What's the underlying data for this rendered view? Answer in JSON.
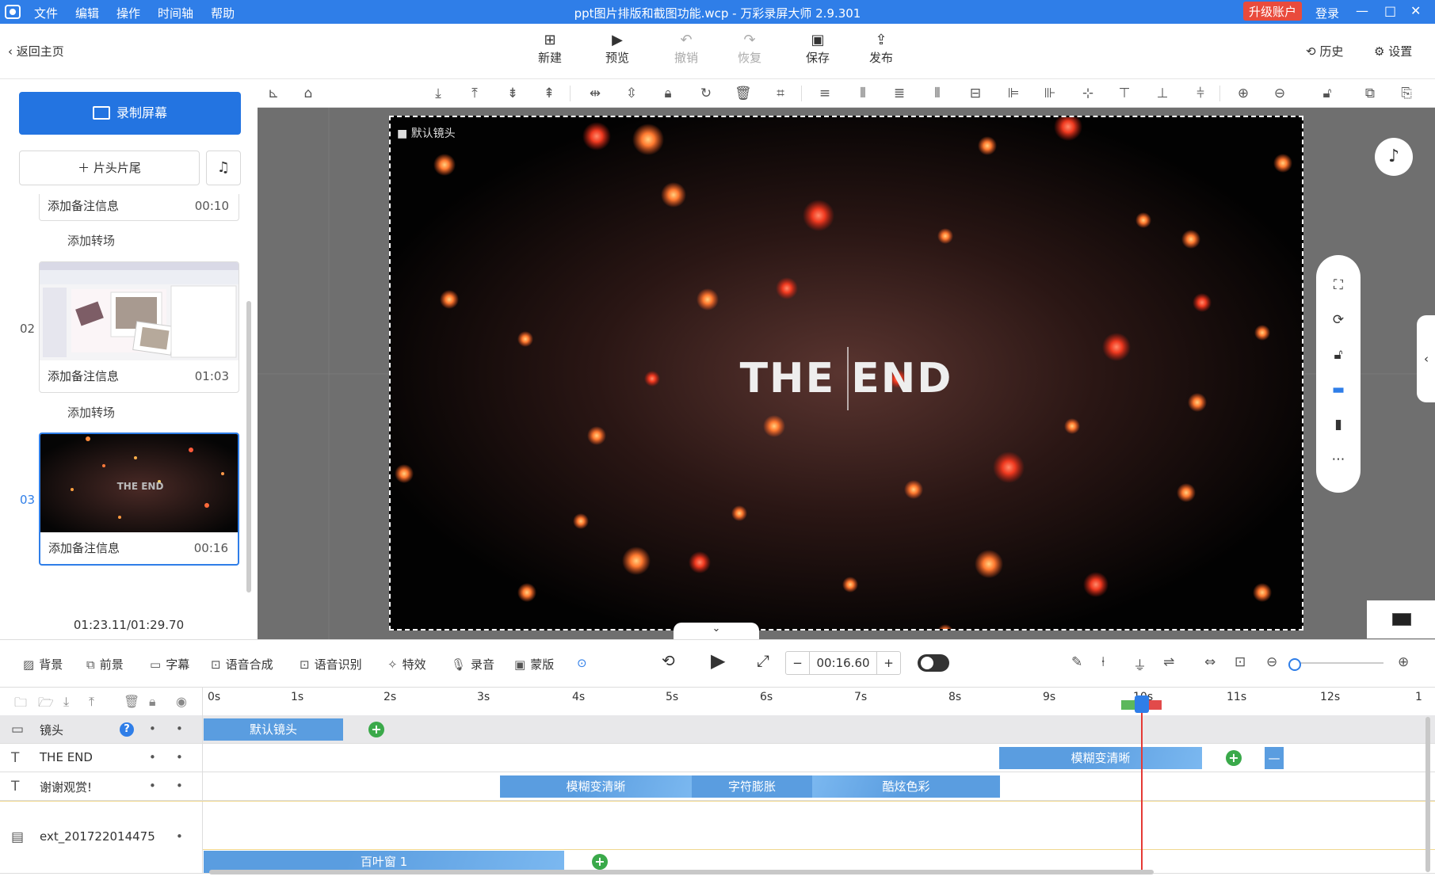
{
  "titlebar": {
    "menu": [
      "文件",
      "编辑",
      "操作",
      "时间轴",
      "帮助"
    ],
    "title": "ppt图片排版和截图功能.wcp - 万彩录屏大师 2.9.301",
    "upgrade": "升级账户",
    "login": "登录"
  },
  "toolbar": {
    "back": "返回主页",
    "new": "新建",
    "preview": "预览",
    "undo": "撤销",
    "redo": "恢复",
    "save": "保存",
    "publish": "发布",
    "history": "历史",
    "settings": "设置"
  },
  "left": {
    "record": "录制屏幕",
    "intro_outro": "片头片尾",
    "clips": [
      {
        "num": "",
        "caption": "添加备注信息",
        "time": "00:10"
      },
      {
        "num": "02",
        "caption": "添加备注信息",
        "time": "01:03"
      },
      {
        "num": "03",
        "caption": "添加备注信息",
        "time": "00:16"
      }
    ],
    "add_transition": "添加转场",
    "total_time": "01:23.11/01:29.70"
  },
  "canvas": {
    "camera_label": "默认镜头",
    "text": "THE END"
  },
  "controls": {
    "background": "背景",
    "foreground": "前景",
    "subtitle": "字幕",
    "tts": "语音合成",
    "asr": "语音识别",
    "effects": "特效",
    "record_audio": "录音",
    "mask": "蒙版",
    "time": "00:16.60"
  },
  "timeline": {
    "ticks": [
      "0s",
      "1s",
      "2s",
      "3s",
      "4s",
      "5s",
      "6s",
      "7s",
      "8s",
      "9s",
      "10s",
      "11s",
      "12s",
      "1"
    ],
    "tracks": [
      {
        "icon": "camera-icon",
        "name": "镜头"
      },
      {
        "icon": "text-icon",
        "name": "THE END"
      },
      {
        "icon": "text-icon",
        "name": "谢谢观赏!"
      },
      {
        "icon": "film-icon",
        "name": "ext_201722014475"
      }
    ],
    "clips": {
      "camera": "默认镜头",
      "theend": "模糊变清晰",
      "thanks_1": "模糊变清晰",
      "thanks_2": "字符膨胀",
      "thanks_3": "酷炫色彩",
      "ext": "百叶窗 1"
    }
  },
  "colors": {
    "accent": "#2f7ee8",
    "upgrade": "#e94b3c",
    "keyframe": "#3aa94a",
    "playhead": "#e53935"
  }
}
